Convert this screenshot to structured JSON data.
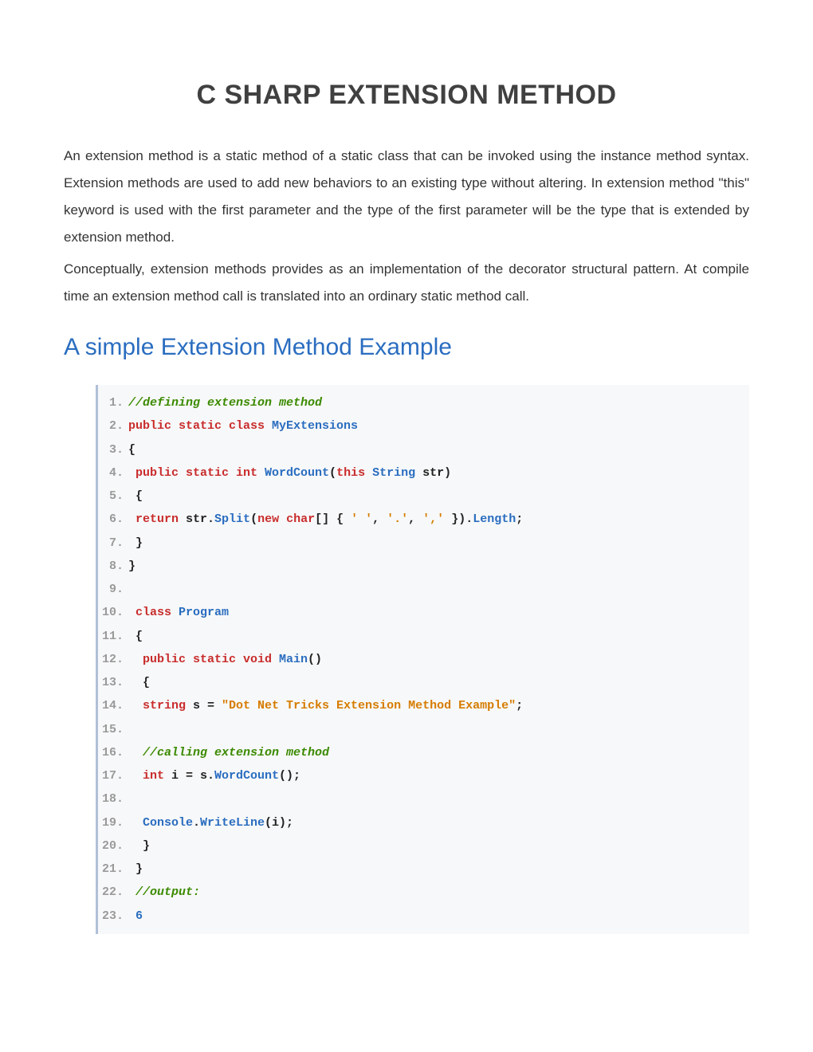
{
  "title": "C SHARP EXTENSION METHOD",
  "para1": "An extension method is a static method of a static class that can be invoked using the instance method syntax. Extension methods are used to add new behaviors to an existing type without altering. In extension method \"this\" keyword is used with the first parameter and the type of the first parameter will be the type that is extended by extension method.",
  "para2": "Conceptually, extension methods provides as an implementation of the decorator structural pattern. At compile time an extension method call is translated into an ordinary static method call.",
  "section_heading": "A simple Extension Method Example",
  "code": {
    "ln": {
      "1": "1.",
      "2": "2.",
      "3": "3.",
      "4": "4.",
      "5": "5.",
      "6": "6.",
      "7": "7.",
      "8": "8.",
      "9": "9.",
      "10": "10.",
      "11": "11.",
      "12": "12.",
      "13": "13.",
      "14": "14.",
      "15": "15.",
      "16": "16.",
      "17": "17.",
      "18": "18.",
      "19": "19.",
      "20": "20.",
      "21": "21.",
      "22": "22.",
      "23": "23."
    },
    "l1_comment": "//defining extension method",
    "l2_kw": "public static class ",
    "l2_type": "MyExtensions",
    "l3": "{",
    "l4_kw1": " public static int ",
    "l4_type1": "WordCount",
    "l4_p1": "(",
    "l4_kw2": "this ",
    "l4_type2": "String",
    "l4_rest": " str)",
    "l5": " {",
    "l6_kw1": " return",
    "l6_p1": " str",
    "l6_dot1": ".",
    "l6_type1": "Split",
    "l6_p2": "(",
    "l6_kw2": "new char",
    "l6_p3": "[] { ",
    "l6_s1": "' '",
    "l6_c1": ", ",
    "l6_s2": "'.'",
    "l6_c2": ", ",
    "l6_s3": "','",
    "l6_p4": " }).",
    "l6_type2": "Length",
    "l6_semi": ";",
    "l7": " }",
    "l8": "}",
    "l10_kw": " class ",
    "l10_type": "Program",
    "l11": " {",
    "l12_kw": "  public static void ",
    "l12_type": "Main",
    "l12_rest": "()",
    "l13": "  {",
    "l14_kw": "  string",
    "l14_p1": " s = ",
    "l14_str": "\"Dot Net Tricks Extension Method Example\"",
    "l14_semi": ";",
    "l16_comment": "  //calling extension method",
    "l17_kw": "  int",
    "l17_p1": " i = s.",
    "l17_type": "WordCount",
    "l17_rest": "();",
    "l19_type1": "  Console",
    "l19_dot": ".",
    "l19_type2": "WriteLine",
    "l19_rest": "(i);",
    "l20": "  }",
    "l21": " }",
    "l22_comment": " //output:",
    "l23_num": " 6"
  }
}
